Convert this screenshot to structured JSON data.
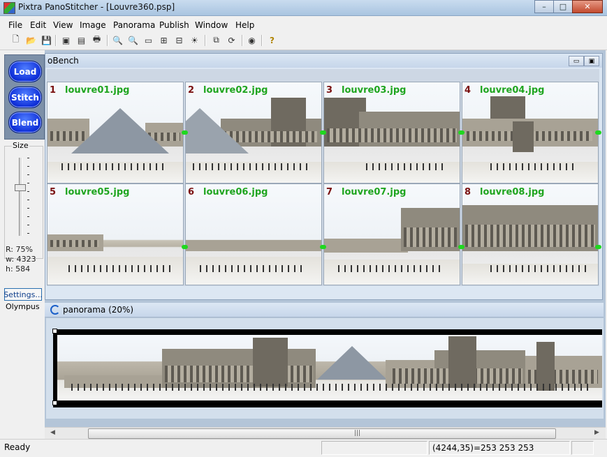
{
  "window": {
    "title": "Pixtra PanoStitcher - [Louvre360.psp]",
    "min_label": "–",
    "max_label": "□",
    "close_label": "✕"
  },
  "menu": [
    {
      "label": "File"
    },
    {
      "label": "Edit"
    },
    {
      "label": "View"
    },
    {
      "label": "Image"
    },
    {
      "label": "Panorama"
    },
    {
      "label": "Publish"
    },
    {
      "label": "Window"
    },
    {
      "label": "Help"
    }
  ],
  "toolbar": {
    "icons": [
      "new-icon",
      "open-icon",
      "save-icon",
      "import-icon",
      "save-as-icon",
      "disk-icon",
      "print-icon",
      "zoom-in-icon",
      "zoom-out-icon",
      "frame-icon",
      "grid-icon",
      "tiles-icon",
      "brightness-icon",
      "panorama-icon",
      "rotate-icon",
      "publish-icon",
      "help-icon"
    ],
    "glyphs": [
      "🗋",
      "📂",
      "💾",
      "▣",
      "▤",
      "💾",
      "🖶",
      "🔍",
      "🔍",
      "▭",
      "⊞",
      "⊟",
      "☀",
      "⧉",
      "⟳",
      "◉",
      "?"
    ]
  },
  "left": {
    "load": "Load",
    "stitch": "Stitch",
    "blend": "Blend",
    "size_label": "Size",
    "ratio": "R: 75%",
    "width": "w: 4323",
    "height": "h: 584",
    "settings": "Settings...",
    "camera": "Olympus"
  },
  "workbench": {
    "title": "oBench",
    "images": [
      {
        "num": "1",
        "name": "louvre01.jpg"
      },
      {
        "num": "2",
        "name": "louvre02.jpg"
      },
      {
        "num": "3",
        "name": "louvre03.jpg"
      },
      {
        "num": "4",
        "name": "louvre04.jpg"
      },
      {
        "num": "5",
        "name": "louvre05.jpg"
      },
      {
        "num": "6",
        "name": "louvre06.jpg"
      },
      {
        "num": "7",
        "name": "louvre07.jpg"
      },
      {
        "num": "8",
        "name": "louvre08.jpg"
      }
    ]
  },
  "panorama": {
    "title": "panorama (20%)"
  },
  "scrollbar": {
    "grip": "|||"
  },
  "status": {
    "text": "Ready",
    "coords": "(4244,35)=253 253 253"
  },
  "colors": {
    "accent_blue": "#0f2fd8",
    "filename_green": "#1fa51f",
    "index_red": "#7a1010",
    "match_green": "#1fd81f"
  }
}
